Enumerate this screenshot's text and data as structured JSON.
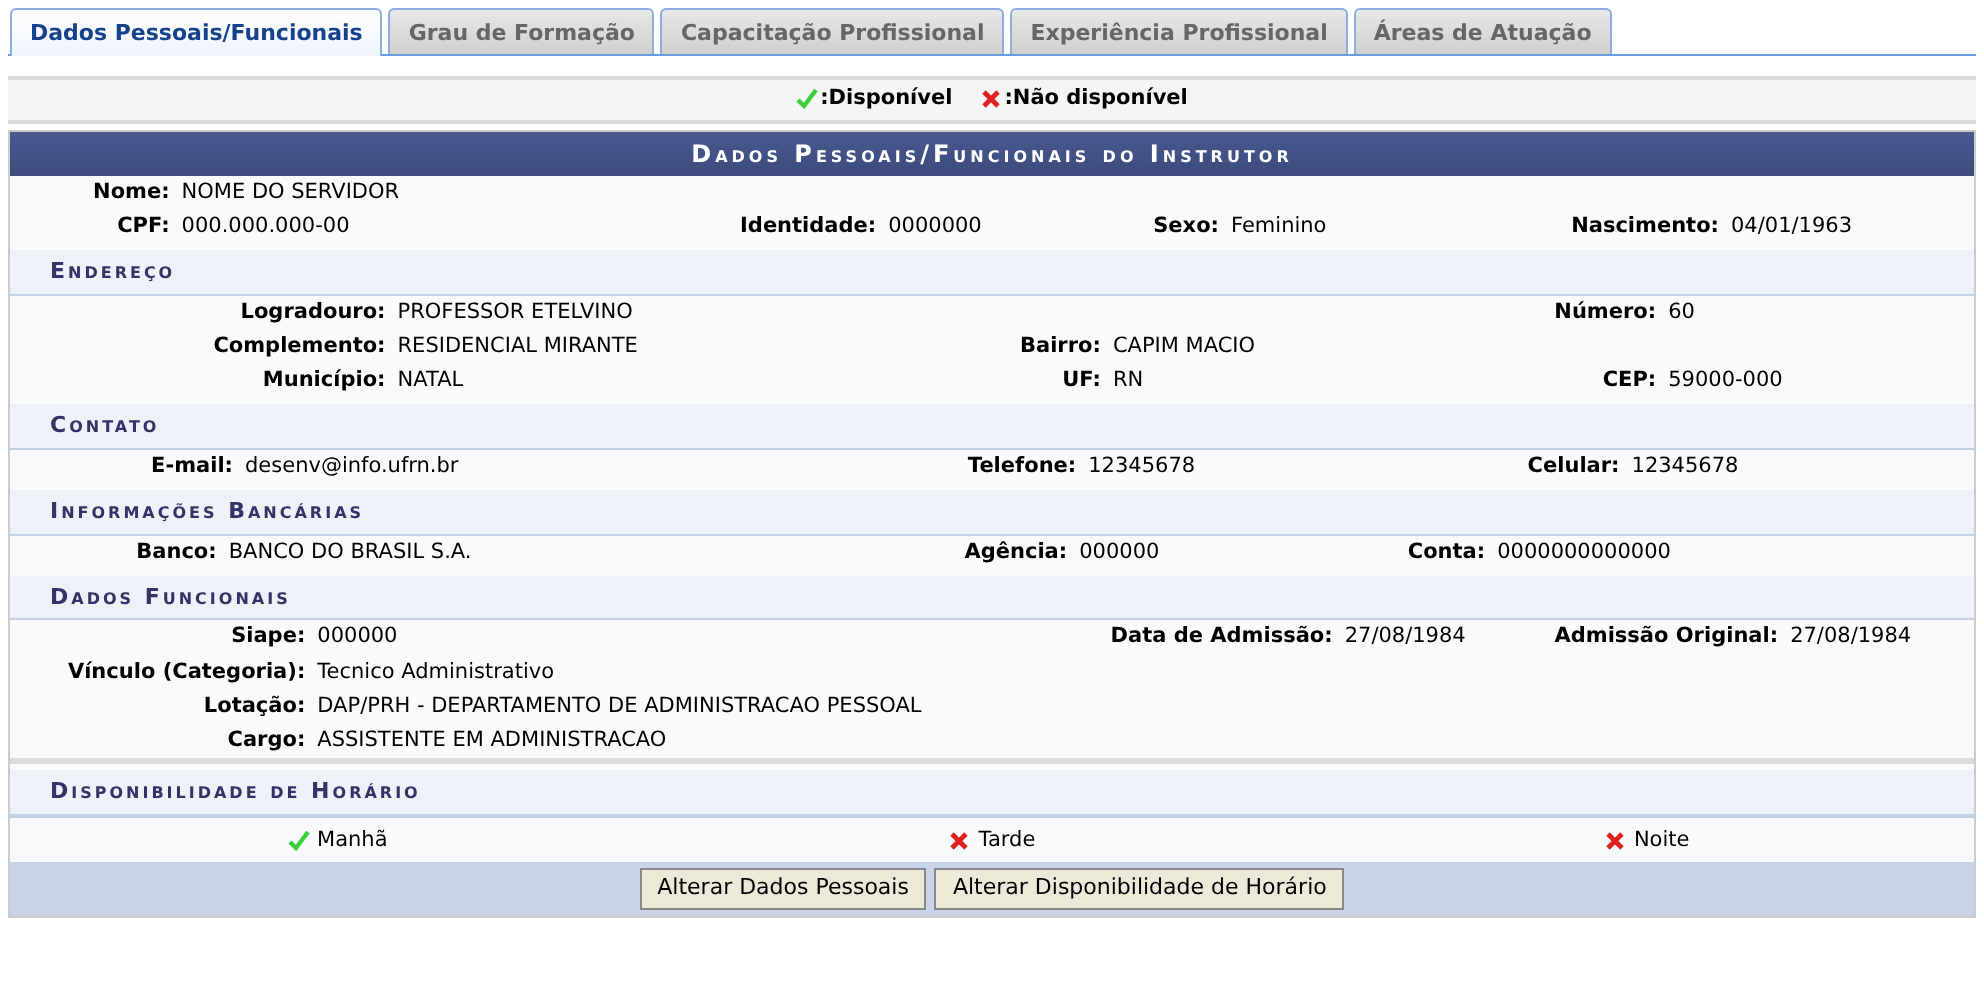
{
  "tabs": [
    {
      "label": "Dados Pessoais/Funcionais",
      "selected": true
    },
    {
      "label": "Grau de Formação",
      "selected": false
    },
    {
      "label": "Capacitação Profissional",
      "selected": false
    },
    {
      "label": "Experiência Profissional",
      "selected": false
    },
    {
      "label": "Áreas de Atuação",
      "selected": false
    }
  ],
  "legend": [
    {
      "label": ":Disponível",
      "available": true
    },
    {
      "label": ":Não disponível",
      "available": false
    }
  ],
  "title": "Dados Pessoais/Funcionais do Instrutor",
  "sections": [
    {
      "rows": [
        [
          {
            "label": "Nome:",
            "value": "NOME DO SERVIDOR"
          }
        ],
        [
          {
            "label": "CPF:",
            "value": "000.000.000-00"
          },
          {
            "label": "Identidade:",
            "value": "0000000"
          },
          {
            "label": "Sexo:",
            "value": "Feminino"
          },
          {
            "label": "Nascimento:",
            "value": "04/01/1963"
          }
        ]
      ]
    },
    {
      "title": "Endereço",
      "rows": [
        [
          {
            "label": "Logradouro:",
            "value": "PROFESSOR ETELVINO"
          },
          null,
          {
            "label": "Número:",
            "value": "60"
          }
        ],
        [
          {
            "label": "Complemento:",
            "value": "RESIDENCIAL MIRANTE"
          },
          {
            "label": "Bairro:",
            "value": "CAPIM MACIO"
          }
        ],
        [
          {
            "label": "Município:",
            "value": "NATAL"
          },
          {
            "label": "UF:",
            "value": "RN"
          },
          {
            "label": "CEP:",
            "value": "59000-000"
          }
        ]
      ]
    },
    {
      "title": "Contato",
      "rows": [
        [
          {
            "label": "E-mail:",
            "value": "desenv@info.ufrn.br"
          },
          {
            "label": "Telefone:",
            "value": "12345678"
          },
          {
            "label": "Celular:",
            "value": "12345678"
          }
        ]
      ]
    },
    {
      "title": "Informações Bancárias",
      "rows": [
        [
          {
            "label": "Banco:",
            "value": "BANCO DO BRASIL S.A."
          },
          {
            "label": "Agência:",
            "value": "000000"
          },
          {
            "label": "Conta:",
            "value": "0000000000000"
          }
        ]
      ]
    },
    {
      "title": "Dados Funcionais",
      "rows": [
        [
          {
            "label": "Siape:",
            "value": "000000"
          },
          {
            "label": "Data de Admissão:",
            "value": "27/08/1984"
          },
          {
            "label": "Admissão Original:",
            "value": "27/08/1984"
          }
        ],
        [
          {
            "label": "Vínculo (Categoria):",
            "value": "Tecnico Administrativo"
          }
        ],
        [
          {
            "label": "Lotação:",
            "value": "DAP/PRH - DEPARTAMENTO DE ADMINISTRACAO PESSOAL"
          }
        ],
        [
          {
            "label": "Cargo:",
            "value": "ASSISTENTE EM ADMINISTRACAO"
          }
        ]
      ]
    }
  ],
  "availability": {
    "title": "Disponibilidade de Horário",
    "items": [
      {
        "label": "Manhã",
        "available": true
      },
      {
        "label": "Tarde",
        "available": false
      },
      {
        "label": "Noite",
        "available": false
      }
    ]
  },
  "buttons": [
    "Alterar Dados Pessoais",
    "Alterar Disponibilidade de Horário"
  ]
}
